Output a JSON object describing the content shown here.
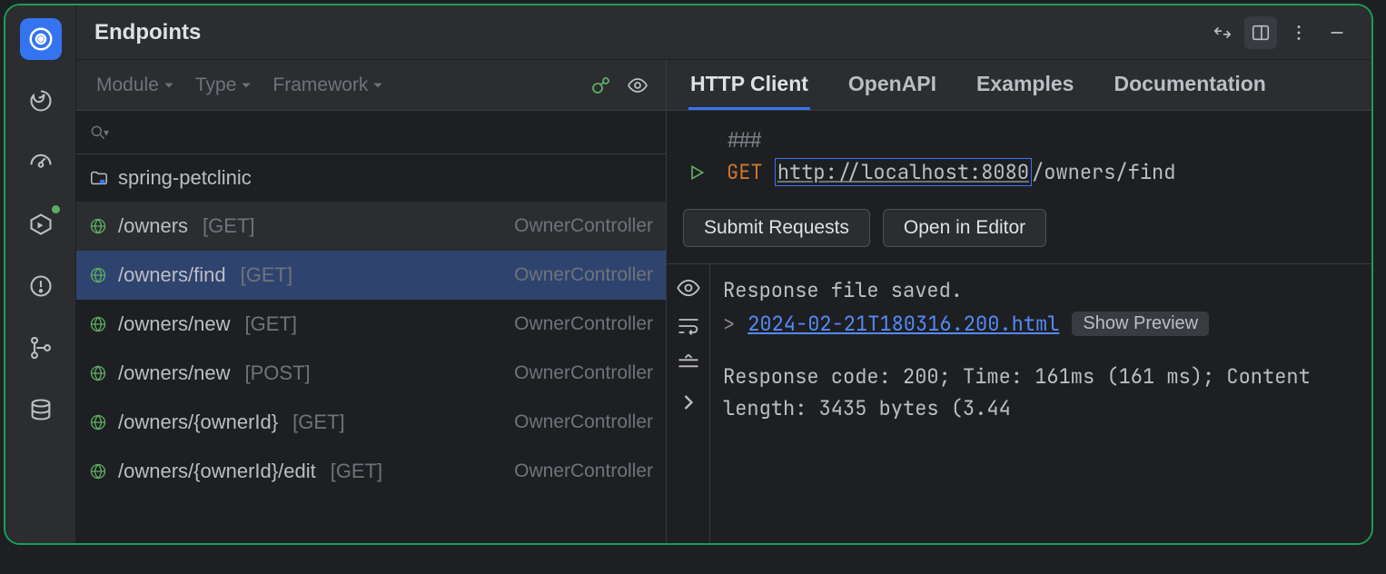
{
  "titlebar": {
    "title": "Endpoints"
  },
  "filters": {
    "module": "Module",
    "type": "Type",
    "framework": "Framework"
  },
  "project": {
    "name": "spring-petclinic"
  },
  "endpoints": [
    {
      "path": "/owners",
      "method": "[GET]",
      "controller": "OwnerController",
      "selected": false,
      "hover": true
    },
    {
      "path": "/owners/find",
      "method": "[GET]",
      "controller": "OwnerController",
      "selected": true,
      "hover": false
    },
    {
      "path": "/owners/new",
      "method": "[GET]",
      "controller": "OwnerController",
      "selected": false,
      "hover": false
    },
    {
      "path": "/owners/new",
      "method": "[POST]",
      "controller": "OwnerController",
      "selected": false,
      "hover": false
    },
    {
      "path": "/owners/{ownerId}",
      "method": "[GET]",
      "controller": "OwnerController",
      "selected": false,
      "hover": false
    },
    {
      "path": "/owners/{ownerId}/edit",
      "method": "[GET]",
      "controller": "OwnerController",
      "selected": false,
      "hover": false
    }
  ],
  "tabs": {
    "http": "HTTP Client",
    "openapi": "OpenAPI",
    "examples": "Examples",
    "docs": "Documentation"
  },
  "request": {
    "marker": "###",
    "verb": "GET",
    "host": "http://localhost:8080",
    "path": "/owners/find"
  },
  "buttons": {
    "submit": "Submit Requests",
    "open": "Open in Editor"
  },
  "response": {
    "saved": "Response file saved.",
    "caret": ">",
    "file": "2024-02-21T180316.200.html",
    "preview": "Show Preview",
    "status": "Response code: 200; Time: 161ms (161 ms); Content length: 3435 bytes (3.44"
  }
}
